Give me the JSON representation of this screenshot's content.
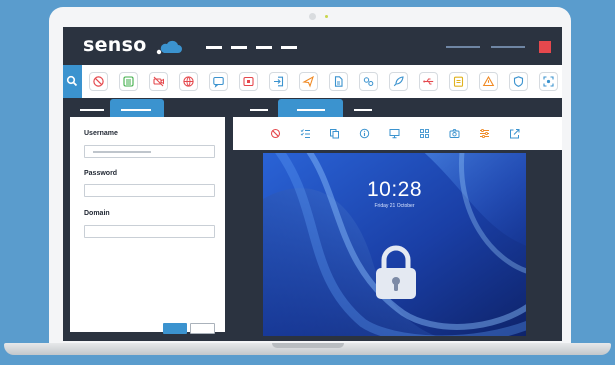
{
  "brand": {
    "name": "senso"
  },
  "login": {
    "username_label": "Username",
    "password_label": "Password",
    "domain_label": "Domain"
  },
  "lockscreen": {
    "time": "10:28",
    "date": "Friday 21 October"
  },
  "toolbar_icons": [
    "block-icon",
    "list-icon",
    "video-off-icon",
    "globe-icon",
    "chat-icon",
    "stop-media-icon",
    "login-icon",
    "send-icon",
    "document-icon",
    "settings-icon",
    "rocket-icon",
    "usb-icon",
    "clipboard-icon",
    "warning-icon",
    "shield-icon",
    "screen-capture-icon"
  ],
  "remote_toolbar_icons": [
    "block-icon",
    "checklist-icon",
    "copy-icon",
    "info-icon",
    "monitor-icon",
    "grid-icon",
    "camera-icon",
    "sliders-icon",
    "share-icon"
  ],
  "colors": {
    "frame_dark": "#2b3340",
    "accent_blue": "#3b93cf",
    "close_red": "#e5484d",
    "background": "#5a9ccd"
  }
}
